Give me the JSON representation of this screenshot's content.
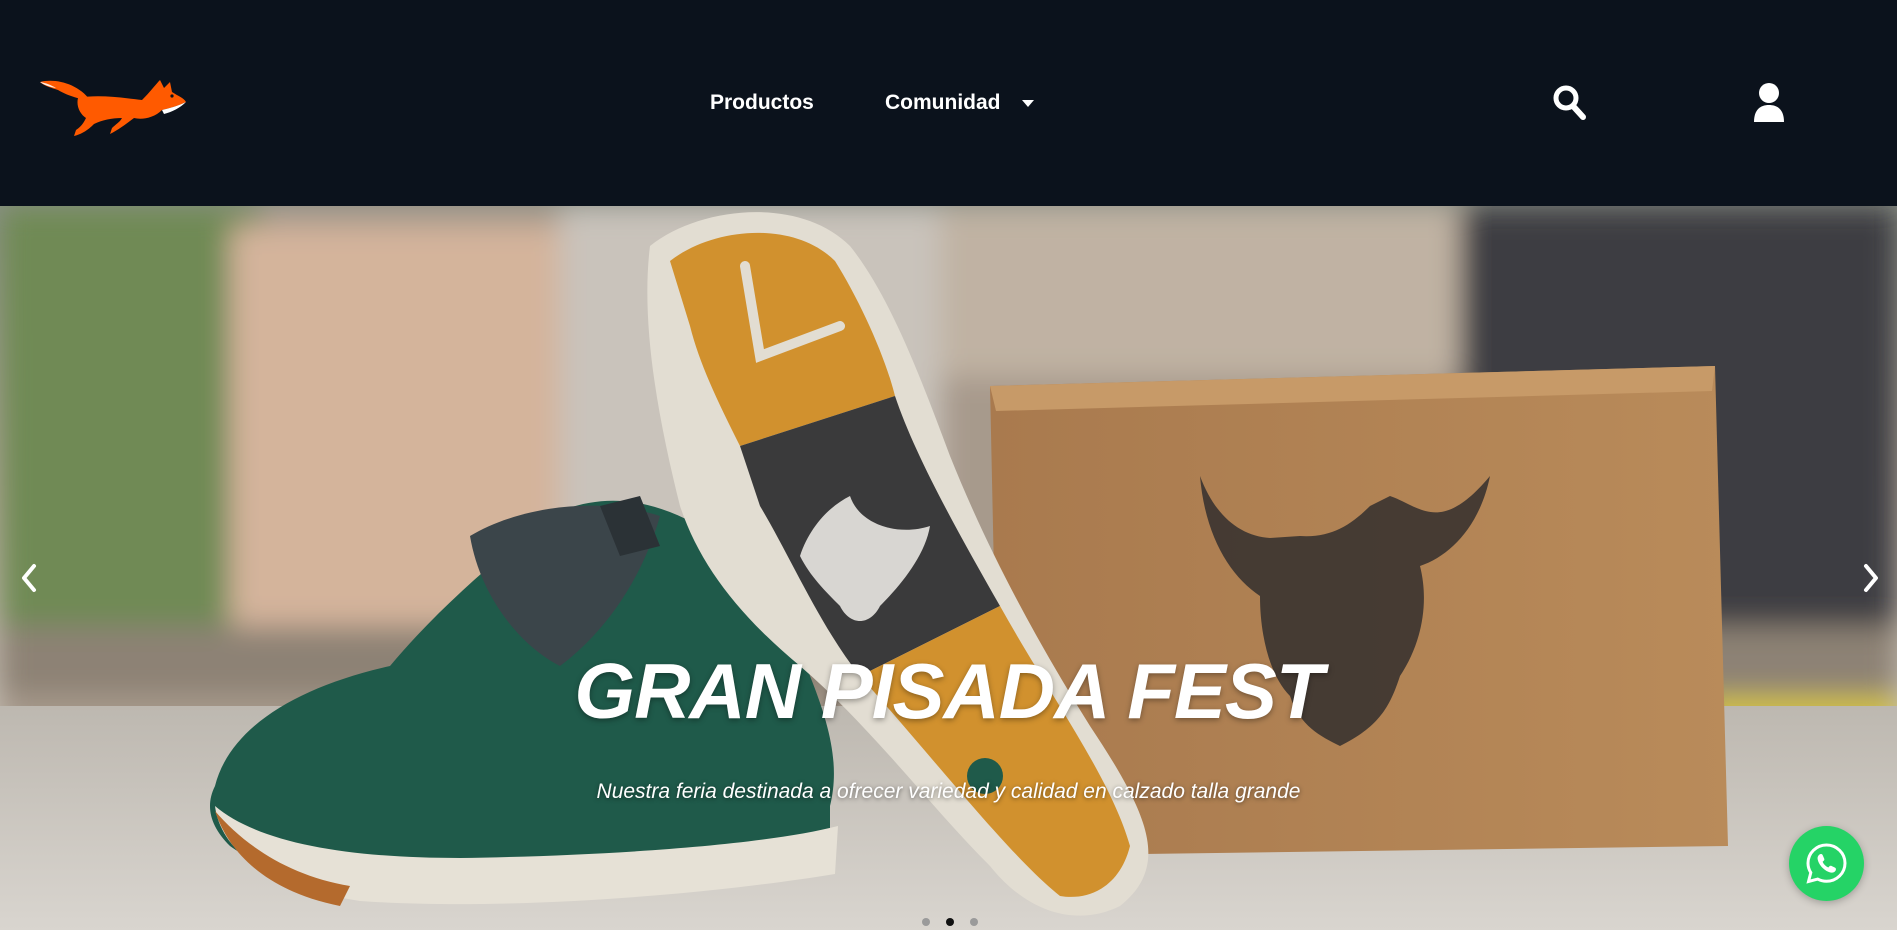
{
  "header": {
    "logo_name": "fox-logo",
    "nav": [
      {
        "label": "Productos"
      },
      {
        "label": "Comunidad",
        "has_dropdown": true
      }
    ],
    "icons": [
      "search-icon",
      "user-icon"
    ]
  },
  "hero": {
    "title": "GRAN PISADA FEST",
    "subtitle": "Nuestra feria destinada a ofrecer variedad y calidad en calzado talla grande",
    "slides_total": 3,
    "active_slide": 2,
    "controls": [
      "chevron-left-icon",
      "chevron-right-icon"
    ]
  },
  "floating": {
    "whatsapp_icon": "whatsapp-icon"
  },
  "colors": {
    "header_bg": "#0b121c",
    "brand_orange": "#ff5a00",
    "whatsapp_green": "#25d366",
    "text": "#ffffff"
  }
}
